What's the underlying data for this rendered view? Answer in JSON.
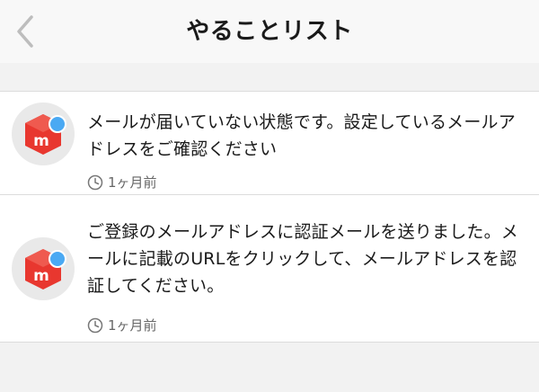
{
  "header": {
    "title": "やることリスト",
    "back_icon": "chevron-left-icon"
  },
  "colors": {
    "brand_red": "#e8372f",
    "badge_blue": "#4aa9f3",
    "avatar_bg": "#e9e9e9"
  },
  "items": [
    {
      "message": "メールが届いていない状態です。設定しているメールアドレスをご確認ください",
      "time": "1ヶ月前",
      "avatar_icon": "mercari-logo-icon",
      "badge": "unread-dot"
    },
    {
      "message": "ご登録のメールアドレスに認証メールを送りました。メールに記載のURLをクリックして、メールアドレスを認証してください。",
      "time": "1ヶ月前",
      "avatar_icon": "mercari-logo-icon",
      "badge": "unread-dot"
    }
  ]
}
